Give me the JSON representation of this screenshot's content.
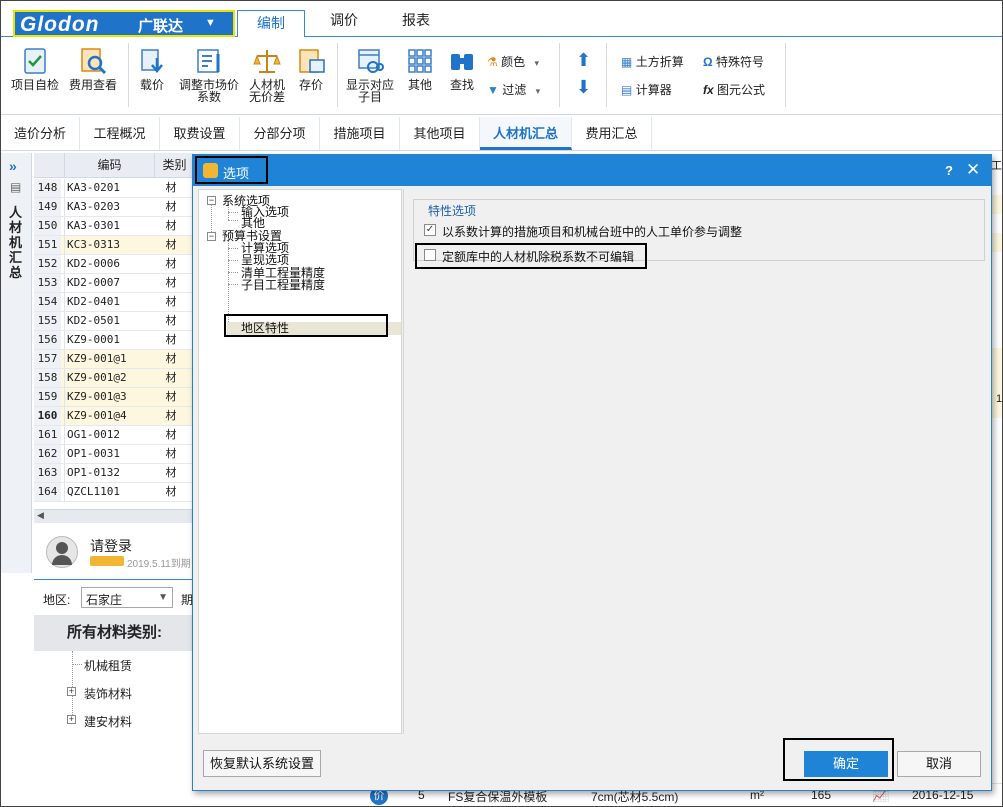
{
  "menu": {
    "logo_text": "Glodon",
    "logo_cn": "广联达",
    "items": [
      "编制",
      "调价",
      "报表"
    ]
  },
  "toolbar": {
    "project_check": "项目自检",
    "fee_view": "费用查看",
    "load_price": "载价",
    "adjust_market_1": "调整市场价",
    "adjust_market_2": "系数",
    "labor_1": "人材机",
    "labor_2": "无价差",
    "save_price": "存价",
    "show_sub_1": "显示对应",
    "show_sub_2": "子目",
    "other": "其他",
    "find": "查找",
    "color": "颜色",
    "filter": "过滤",
    "earthwork": "土方折算",
    "special_symbol": "特殊符号",
    "calculator": "计算器",
    "formula": "图元公式"
  },
  "tabs": [
    "造价分析",
    "工程概况",
    "取费设置",
    "分部分项",
    "措施项目",
    "其他项目",
    "人材机汇总",
    "费用汇总"
  ],
  "side": {
    "vertical_title": "人材机汇总"
  },
  "grid": {
    "col_code": "编码",
    "col_type": "类别",
    "rows": [
      {
        "n": "148",
        "code": "KA3-0201",
        "type": "材",
        "hl": false
      },
      {
        "n": "149",
        "code": "KA3-0203",
        "type": "材",
        "hl": false
      },
      {
        "n": "150",
        "code": "KA3-0301",
        "type": "材",
        "hl": false
      },
      {
        "n": "151",
        "code": "KC3-0313",
        "type": "材",
        "hl": true
      },
      {
        "n": "152",
        "code": "KD2-0006",
        "type": "材",
        "hl": false
      },
      {
        "n": "153",
        "code": "KD2-0007",
        "type": "材",
        "hl": false
      },
      {
        "n": "154",
        "code": "KD2-0401",
        "type": "材",
        "hl": false
      },
      {
        "n": "155",
        "code": "KD2-0501",
        "type": "材",
        "hl": false
      },
      {
        "n": "156",
        "code": "KZ9-0001",
        "type": "材",
        "hl": false
      },
      {
        "n": "157",
        "code": "KZ9-001@1",
        "type": "材",
        "hl": true
      },
      {
        "n": "158",
        "code": "KZ9-001@2",
        "type": "材",
        "hl": true
      },
      {
        "n": "159",
        "code": "KZ9-001@3",
        "type": "材",
        "hl": true
      },
      {
        "n": "160",
        "code": "KZ9-001@4",
        "type": "材",
        "hl": true
      },
      {
        "n": "161",
        "code": "OG1-0012",
        "type": "材",
        "hl": false
      },
      {
        "n": "162",
        "code": "OP1-0031",
        "type": "材",
        "hl": false
      },
      {
        "n": "163",
        "code": "OP1-0132",
        "type": "材",
        "hl": false
      },
      {
        "n": "164",
        "code": "QZCL1101",
        "type": "材",
        "hl": false
      }
    ]
  },
  "login": {
    "text": "请登录",
    "sub": "2019.5.11到期"
  },
  "region": {
    "label": "地区:",
    "value": "石家庄",
    "trailing": "期"
  },
  "categories": {
    "header": "所有材料类别:",
    "items": [
      "机械租赁",
      "装饰材料",
      "建安材料"
    ]
  },
  "bottom_row": {
    "badge": "价",
    "num": "5",
    "name": "FS复合保温外模板",
    "spec": "7cm(芯材5.5cm)",
    "unit": "m²",
    "qty": "165",
    "date": "2016-12-15"
  },
  "right_edge": {
    "top": "工地",
    "mid": "1"
  },
  "dialog": {
    "title": "选项",
    "help": "?",
    "close": "✕",
    "tree": {
      "system": "系统选项",
      "input": "输入选项",
      "other": "其他",
      "budget": "预算书设置",
      "calc": "计算选项",
      "display": "呈现选项",
      "bill_precision": "清单工程量精度",
      "sub_precision": "子目工程量精度",
      "region": "地区特性"
    },
    "group_title": "特性选项",
    "opt1": "以系数计算的措施项目和机械台班中的人工单价参与调整",
    "opt1_checked": true,
    "opt2": "定额库中的人材机除税系数不可编辑",
    "opt2_checked": false,
    "restore_btn": "恢复默认系统设置",
    "ok_btn": "确定",
    "cancel_btn": "取消"
  }
}
